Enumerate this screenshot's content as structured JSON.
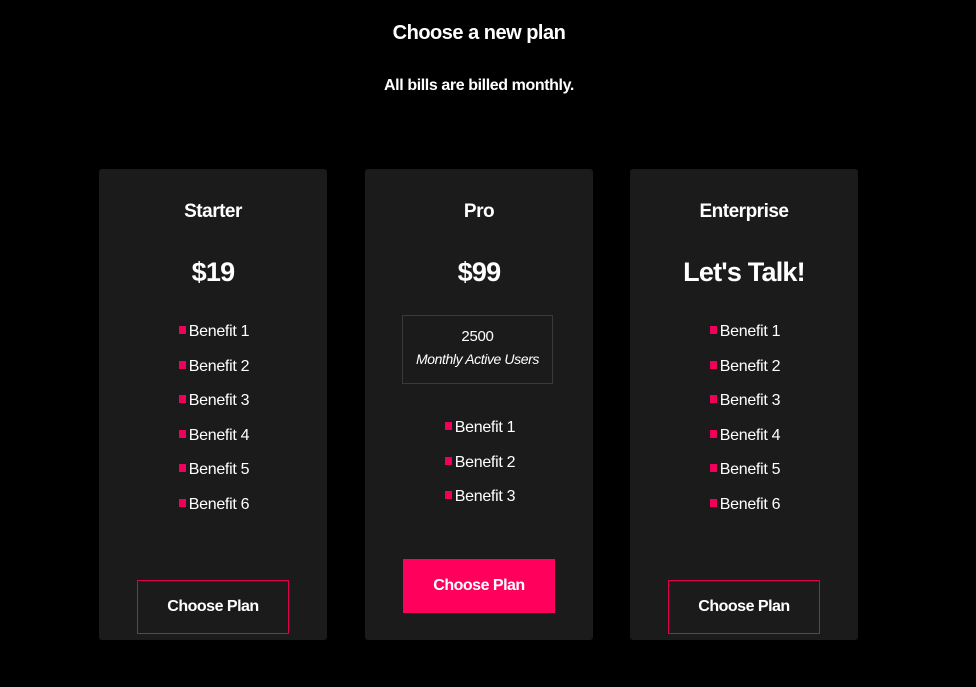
{
  "header": {
    "title": "Choose a new plan",
    "subtitle": "All bills are billed monthly."
  },
  "colors": {
    "background": "#000000",
    "card": "#1b1b1b",
    "accent": "#ff005c",
    "text": "#ffffff"
  },
  "plans": [
    {
      "name": "Starter",
      "price": "$19",
      "benefits": [
        "Benefit 1",
        "Benefit 2",
        "Benefit 3",
        "Benefit 4",
        "Benefit 5",
        "Benefit 6"
      ],
      "button_label": "Choose Plan",
      "button_style": "outline"
    },
    {
      "name": "Pro",
      "price": "$99",
      "usage": {
        "value": "2500",
        "label": "Monthly Active Users"
      },
      "benefits": [
        "Benefit 1",
        "Benefit 2",
        "Benefit 3"
      ],
      "button_label": "Choose Plan",
      "button_style": "filled"
    },
    {
      "name": "Enterprise",
      "price": "Let's Talk!",
      "benefits": [
        "Benefit 1",
        "Benefit 2",
        "Benefit 3",
        "Benefit 4",
        "Benefit 5",
        "Benefit 6"
      ],
      "button_label": "Choose Plan",
      "button_style": "outline"
    }
  ]
}
